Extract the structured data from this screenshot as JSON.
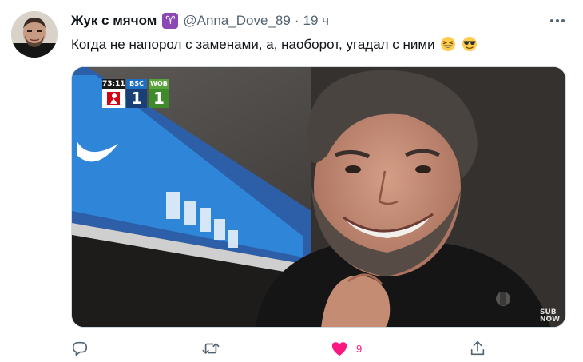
{
  "tweet": {
    "author": {
      "display_name": "Жук с мячом",
      "badge_icon": "aries-zodiac-icon",
      "badge_glyph": "♈",
      "handle": "@Anna_Dove_89",
      "time": "19 ч"
    },
    "text": "Когда не напорол с заменами, а, наоборот, угадал с ними",
    "text_emojis": [
      "grinning-squinting-face-emoji",
      "smiling-face-with-sunglasses-emoji"
    ],
    "media": {
      "scoreboard": {
        "clock": "73:11",
        "home_team": "BSC",
        "home_score": "1",
        "away_team": "WOB",
        "away_score": "1",
        "home_color": "#1e6fc1",
        "away_color": "#5aa33a"
      },
      "watermark_line1": "SUB",
      "watermark_line2": "NOW"
    },
    "actions": {
      "reply_icon": "reply-bubble-icon",
      "retweet_icon": "retweet-arrows-icon",
      "like_icon": "heart-filled-icon",
      "like_count": "9",
      "like_color": "#f91880",
      "share_icon": "share-upload-icon"
    },
    "more_icon": "more-horizontal-icon"
  }
}
